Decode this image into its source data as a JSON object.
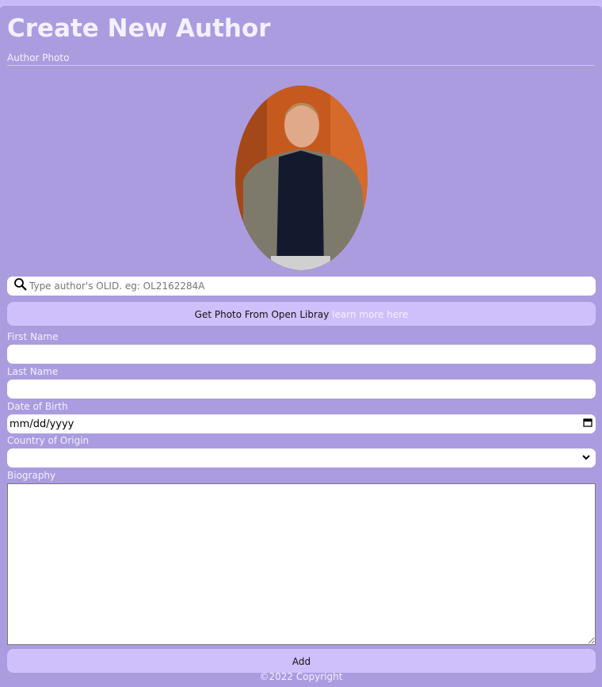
{
  "page": {
    "title": "Create New Author"
  },
  "photo": {
    "label": "Author Photo"
  },
  "search": {
    "placeholder": "Type author's OLID. eg: OL2162284A",
    "icon": "search-icon"
  },
  "get_photo": {
    "label": "Get Photo From Open Libray",
    "link": "learn more here"
  },
  "fields": {
    "first_name": {
      "label": "First Name",
      "value": ""
    },
    "last_name": {
      "label": "Last Name",
      "value": ""
    },
    "dob": {
      "label": "Date of Birth",
      "placeholder": "mm/dd/yyyy"
    },
    "country": {
      "label": "Country of Origin",
      "value": ""
    },
    "bio": {
      "label": "Biography",
      "value": ""
    }
  },
  "add_label": "Add",
  "footer": "©2022 Copyright",
  "colors": {
    "card": "#ab9ce0",
    "button": "#cfc0fc",
    "background": "#c7b8fb"
  }
}
